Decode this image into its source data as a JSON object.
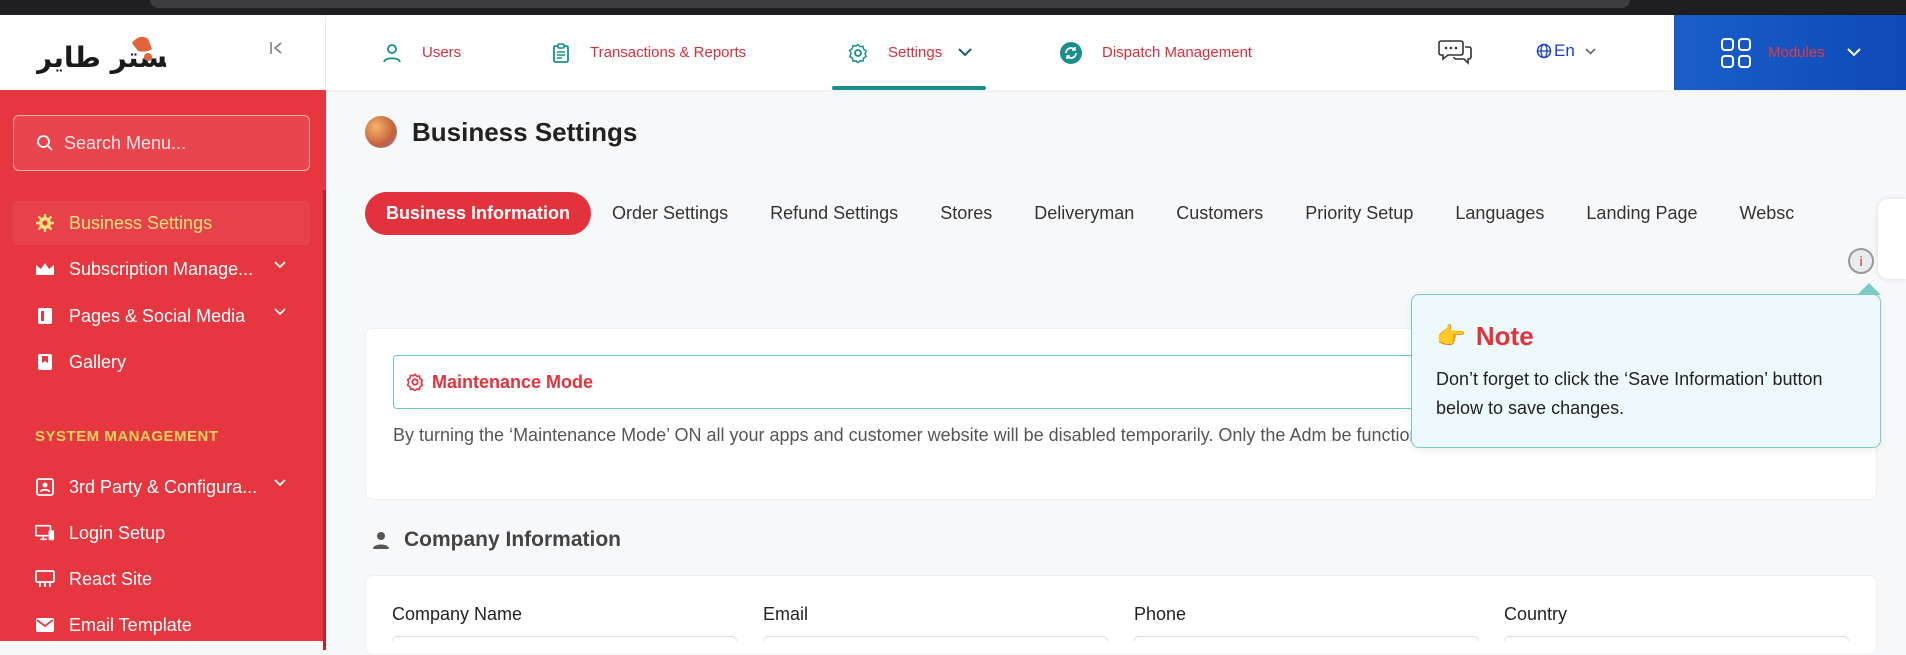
{
  "brand": {
    "logo_text": "مستر طاير"
  },
  "sidebar": {
    "search_placeholder": "Search Menu...",
    "items": [
      {
        "label": "Business Settings",
        "icon": "gear-icon",
        "active": true
      },
      {
        "label": "Subscription Manage...",
        "icon": "crown-icon"
      },
      {
        "label": "Pages & Social Media",
        "icon": "page-icon"
      },
      {
        "label": "Gallery",
        "icon": "bookmark-icon"
      }
    ],
    "section_title": "SYSTEM MANAGEMENT",
    "system_items": [
      {
        "label": "3rd Party & Configura...",
        "icon": "contact-card-icon"
      },
      {
        "label": "Login Setup",
        "icon": "monitor-icon"
      },
      {
        "label": "React Site",
        "icon": "web-icon"
      },
      {
        "label": "Email Template",
        "icon": "email-icon"
      }
    ]
  },
  "topbar": {
    "nav": [
      {
        "label": "Users",
        "icon": "user-icon"
      },
      {
        "label": "Transactions & Reports",
        "icon": "clipboard-icon"
      },
      {
        "label": "Settings",
        "icon": "gear-icon",
        "active": true
      },
      {
        "label": "Dispatch Management",
        "icon": "refresh-icon"
      }
    ],
    "language": "En",
    "modules_label": "Modules"
  },
  "page": {
    "title": "Business Settings",
    "tabs": [
      "Business Information",
      "Order Settings",
      "Refund Settings",
      "Stores",
      "Deliveryman",
      "Customers",
      "Priority Setup",
      "Languages",
      "Landing Page",
      "Websc"
    ],
    "active_tab": "Business Information",
    "maintenance": {
      "title": "Maintenance Mode",
      "description": "By turning the ‘Maintenance Mode’ ON all your apps and customer website will be disabled temporarily. Only the Adm be functional."
    },
    "company": {
      "title": "Company Information",
      "fields": [
        "Company Name",
        "Email",
        "Phone",
        "Country"
      ]
    }
  },
  "note": {
    "title": "Note",
    "body": "Don’t forget to click the ‘Save Information’ button below to save changes."
  },
  "colors": {
    "sidebar": "#e6363f",
    "accent_red": "#e2323c",
    "teal": "#1a8f8a",
    "modules_blue": "#0d49b7",
    "active_menu_text": "#f3e07a"
  }
}
